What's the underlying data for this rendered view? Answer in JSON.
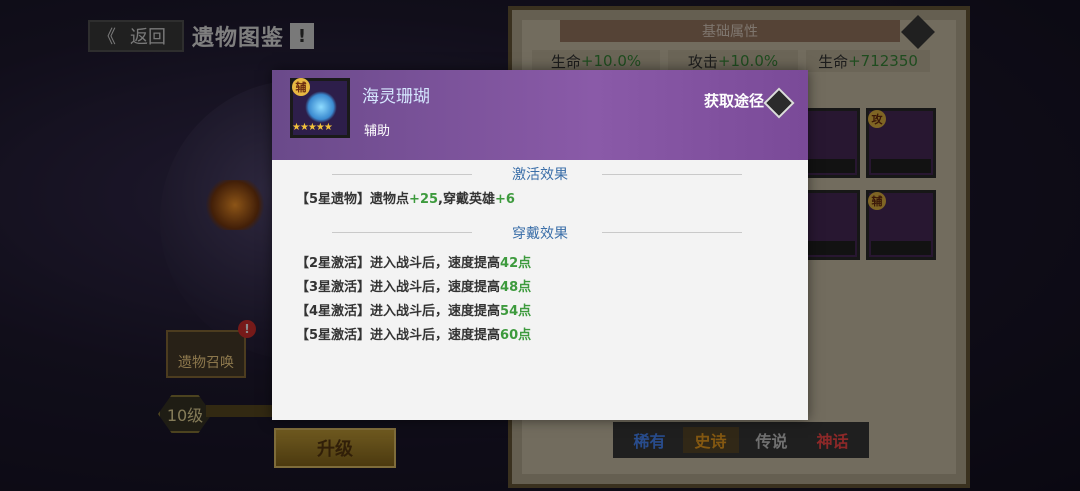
{
  "topbar": {
    "back_label": "返回",
    "title": "遗物图鉴",
    "info_badge": "!"
  },
  "left": {
    "summon_label": "遗物召唤",
    "summon_alert": "!",
    "level_label": "10级",
    "upgrade_label": "升级"
  },
  "right": {
    "attr_header": "基础属性",
    "stats": [
      {
        "label": "生命",
        "value": "+10.0%"
      },
      {
        "label": "攻击",
        "value": "+10.0%"
      },
      {
        "label": "生命",
        "value": "+712350"
      }
    ],
    "card_tags": [
      "攻",
      "辅"
    ],
    "tabs": [
      "稀有",
      "史诗",
      "传说",
      "神话"
    ]
  },
  "modal": {
    "relic_name": "海灵珊瑚",
    "relic_type": "辅助",
    "relic_tag": "辅",
    "relic_stars": "★★★★★",
    "acquire_label": "获取途径",
    "activate_title": "激活效果",
    "activate_line": {
      "prefix": "【5星遗物】遗物点",
      "p1": "+25",
      "mid": ",穿戴英雄",
      "p2": "+6"
    },
    "wear_title": "穿戴效果",
    "wear_lines": [
      {
        "prefix": "【2星激活】进入战斗后，速度提高",
        "value": "42点"
      },
      {
        "prefix": "【3星激活】进入战斗后，速度提高",
        "value": "48点"
      },
      {
        "prefix": "【4星激活】进入战斗后，速度提高",
        "value": "54点"
      },
      {
        "prefix": "【5星激活】进入战斗后，速度提高",
        "value": "60点"
      }
    ]
  },
  "colors": {
    "accent_green": "#3d9a3d",
    "section_blue": "#3a6ea8",
    "modal_purple": "#8a5aa8"
  }
}
